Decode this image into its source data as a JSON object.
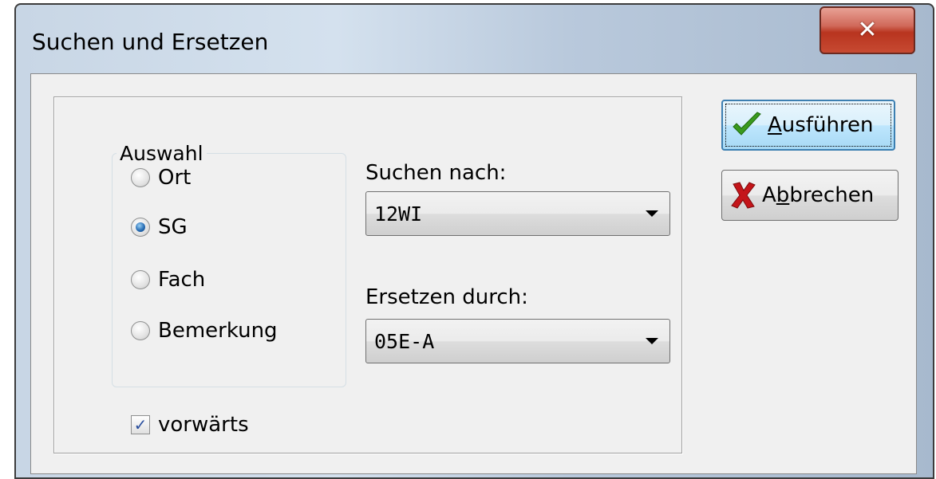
{
  "window": {
    "title": "Suchen und Ersetzen",
    "close_icon": "close-icon"
  },
  "auswahl": {
    "legend": "Auswahl",
    "options": [
      {
        "label": "Ort",
        "selected": false
      },
      {
        "label": "SG",
        "selected": true
      },
      {
        "label": "Fach",
        "selected": false
      },
      {
        "label": "Bemerkung",
        "selected": false
      }
    ]
  },
  "search": {
    "label": "Suchen nach:",
    "value": "12WI"
  },
  "replace": {
    "label": "Ersetzen durch:",
    "value": "05E-A"
  },
  "forward": {
    "label": "vorwärts",
    "checked": true
  },
  "buttons": {
    "execute_prefix": "",
    "execute_mnemonic": "A",
    "execute_rest": "usführen",
    "cancel_prefix": "A",
    "cancel_mnemonic": "b",
    "cancel_rest": "brechen"
  },
  "colors": {
    "check_icon": "#3a9a1e",
    "cancel_icon": "#c4151a",
    "close_button": "#c74a32",
    "default_button_border": "#3c7fb1"
  }
}
